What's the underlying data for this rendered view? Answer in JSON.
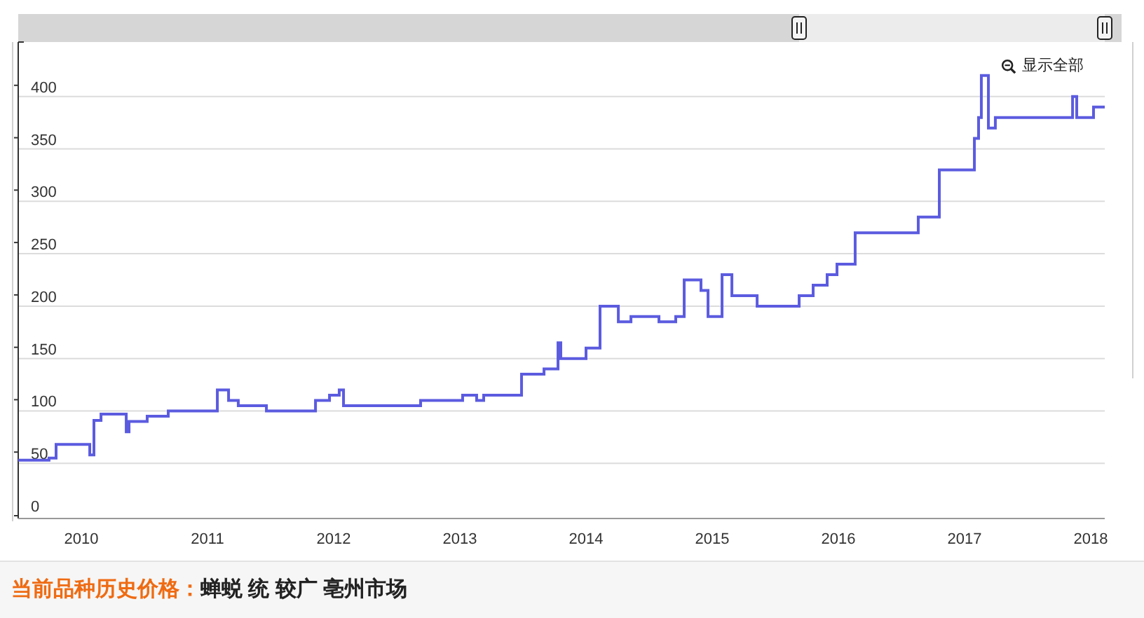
{
  "chart": {
    "reset_zoom_button": "显示全部",
    "chart_data": {
      "type": "line",
      "grid": true,
      "xlim": [
        2009.5,
        2018.111
      ],
      "ylim": [
        0,
        452
      ],
      "xticks": [
        2010,
        2011,
        2012,
        2013,
        2014,
        2015,
        2016,
        2017,
        2018
      ],
      "yticks": [
        0,
        50,
        100,
        150,
        200,
        250,
        300,
        350,
        400
      ],
      "series": [
        {
          "color": "#5b5be0",
          "x": [
            2009.5,
            2009.744,
            2009.744,
            2009.8,
            2009.8,
            2010.067,
            2010.067,
            2010.1,
            2010.1,
            2010.156,
            2010.156,
            2010.356,
            2010.356,
            2010.378,
            2010.378,
            2010.522,
            2010.522,
            2010.689,
            2010.689,
            2011.078,
            2011.078,
            2011.167,
            2011.167,
            2011.244,
            2011.244,
            2011.467,
            2011.467,
            2011.856,
            2011.856,
            2011.967,
            2011.967,
            2012.044,
            2012.044,
            2012.078,
            2012.078,
            2012.689,
            2012.689,
            2013.022,
            2013.022,
            2013.133,
            2013.133,
            2013.189,
            2013.189,
            2013.489,
            2013.489,
            2013.667,
            2013.667,
            2013.778,
            2013.778,
            2013.8,
            2013.8,
            2014.0,
            2014.0,
            2014.111,
            2014.111,
            2014.256,
            2014.256,
            2014.356,
            2014.356,
            2014.578,
            2014.578,
            2014.711,
            2014.711,
            2014.778,
            2014.778,
            2014.911,
            2014.911,
            2014.967,
            2014.967,
            2015.078,
            2015.078,
            2015.156,
            2015.156,
            2015.356,
            2015.356,
            2015.689,
            2015.689,
            2015.8,
            2015.8,
            2015.911,
            2015.911,
            2015.989,
            2015.989,
            2016.133,
            2016.133,
            2016.633,
            2016.633,
            2016.8,
            2016.8,
            2017.078,
            2017.078,
            2017.111,
            2017.111,
            2017.133,
            2017.133,
            2017.189,
            2017.189,
            2017.244,
            2017.244,
            2017.856,
            2017.856,
            2017.889,
            2017.889,
            2018.022,
            2018.022,
            2018.111
          ],
          "values": [
            53,
            53,
            55,
            55,
            68,
            68,
            58,
            58,
            91,
            91,
            97,
            97,
            80,
            80,
            90,
            90,
            95,
            95,
            100,
            100,
            120,
            120,
            110,
            110,
            105,
            105,
            100,
            100,
            110,
            110,
            115,
            115,
            120,
            120,
            105,
            105,
            110,
            110,
            115,
            115,
            110,
            110,
            115,
            115,
            135,
            135,
            140,
            140,
            165,
            165,
            150,
            150,
            160,
            160,
            200,
            200,
            185,
            185,
            190,
            190,
            185,
            185,
            190,
            190,
            225,
            225,
            215,
            215,
            190,
            190,
            230,
            230,
            210,
            210,
            200,
            200,
            210,
            210,
            220,
            220,
            230,
            230,
            240,
            240,
            270,
            270,
            285,
            285,
            330,
            330,
            360,
            360,
            380,
            380,
            420,
            420,
            370,
            370,
            380,
            380,
            400,
            400,
            380,
            380,
            390,
            390
          ]
        }
      ]
    }
  },
  "caption": {
    "label": "当前品种历史价格：",
    "value": "蝉蜕 统 较广 亳州市场"
  }
}
